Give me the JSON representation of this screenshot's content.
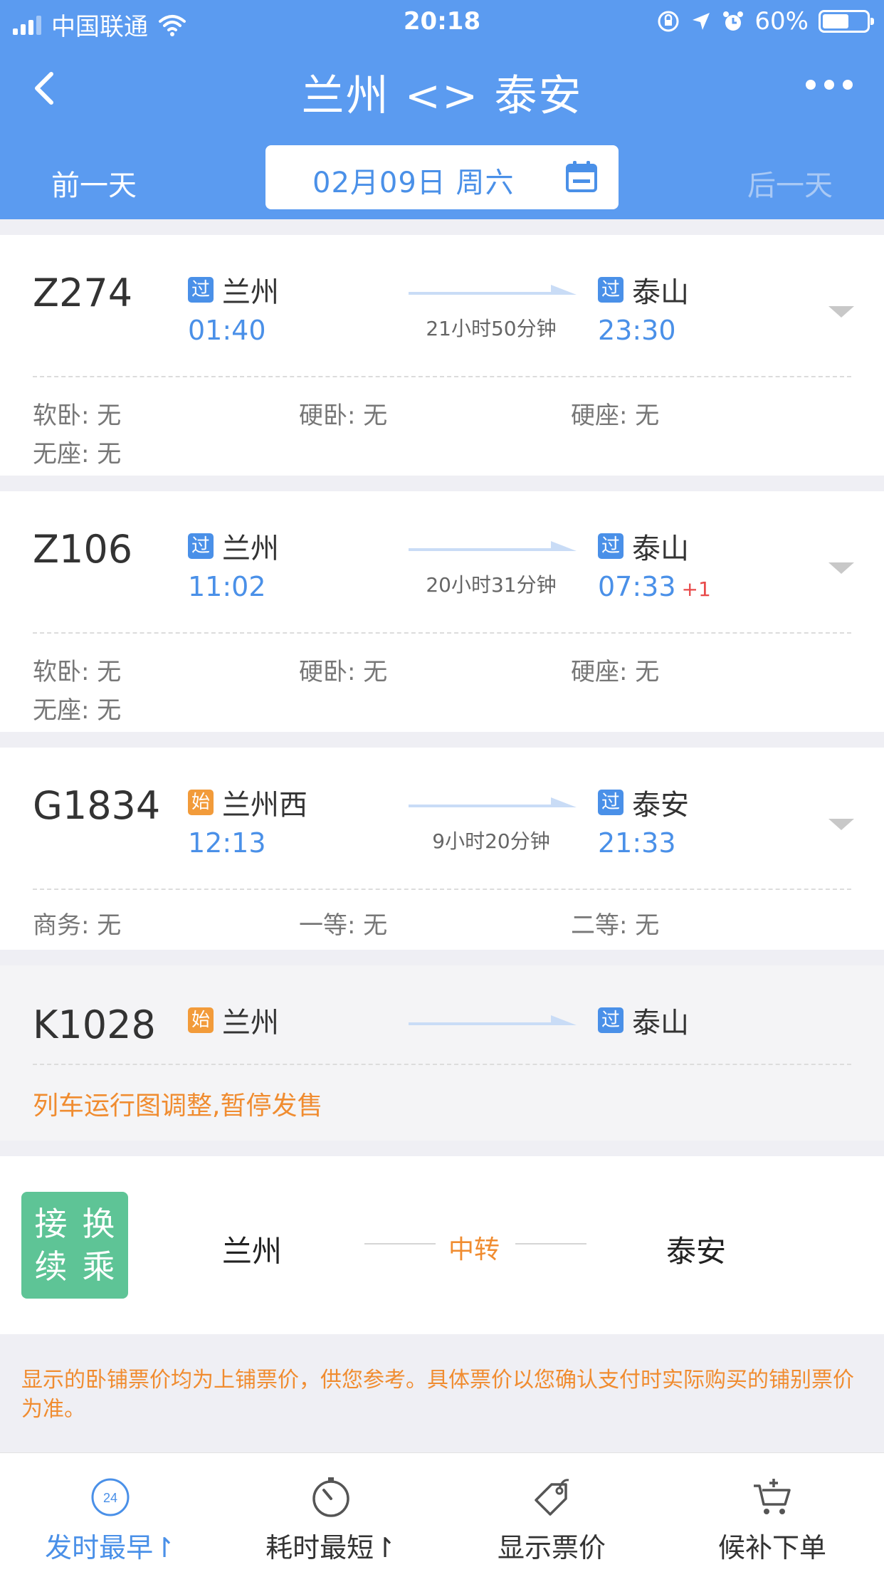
{
  "status_bar": {
    "carrier": "中国联通",
    "time": "20:18",
    "battery": "60%",
    "battery_level": 0.6
  },
  "nav": {
    "title": "兰州 <> 泰安",
    "back_icon": "chevron-left-icon",
    "more_icon": "more-dots-icon"
  },
  "date_bar": {
    "prev_label": "前一天",
    "date": "02月09日 周六",
    "next_label": "后一天",
    "calendar_icon": "calendar-icon"
  },
  "trains": [
    {
      "number": "Z274",
      "from_tag": "过",
      "from": "兰州",
      "depart": "01:40",
      "duration": "21小时50分钟",
      "to_tag": "过",
      "to": "泰山",
      "arrive": "23:30",
      "day_offset": "",
      "seats": [
        "软卧: 无",
        "硬卧: 无",
        "硬座: 无",
        "无座: 无"
      ]
    },
    {
      "number": "Z106",
      "from_tag": "过",
      "from": "兰州",
      "depart": "11:02",
      "duration": "20小时31分钟",
      "to_tag": "过",
      "to": "泰山",
      "arrive": "07:33",
      "day_offset": "+1",
      "seats": [
        "软卧: 无",
        "硬卧: 无",
        "硬座: 无",
        "无座: 无"
      ]
    },
    {
      "number": "G1834",
      "from_tag": "始",
      "from": "兰州西",
      "depart": "12:13",
      "duration": "9小时20分钟",
      "to_tag": "过",
      "to": "泰安",
      "arrive": "21:33",
      "day_offset": "",
      "seats": [
        "商务: 无",
        "一等: 无",
        "二等: 无"
      ]
    },
    {
      "number": "K1028",
      "from_tag": "始",
      "from": "兰州",
      "to_tag": "过",
      "to": "泰山",
      "notice": "列车运行图调整,暂停发售"
    }
  ],
  "transfer": {
    "badge": [
      "接",
      "换",
      "续",
      "乘"
    ],
    "from": "兰州",
    "middle": "中转",
    "to": "泰安"
  },
  "disclaimer": "显示的卧铺票价均为上铺票价，供您参考。具体票价以您确认支付时实际购买的铺别票价为准。",
  "toolbar": {
    "items": [
      {
        "label": "发时最早",
        "icon": "clock-24-icon",
        "active": true
      },
      {
        "label": "耗时最短",
        "icon": "stopwatch-icon",
        "active": false
      },
      {
        "label": "显示票价",
        "icon": "price-tag-icon",
        "active": false
      },
      {
        "label": "候补下单",
        "icon": "cart-add-icon",
        "active": false
      }
    ],
    "icon_number": "24",
    "sort_marker": "↾"
  },
  "colors": {
    "header_blue": "#5b9bf0",
    "accent_blue": "#4a90e8",
    "orange": "#f08c30",
    "green_badge": "#5ec496",
    "red": "#e84a4a"
  }
}
